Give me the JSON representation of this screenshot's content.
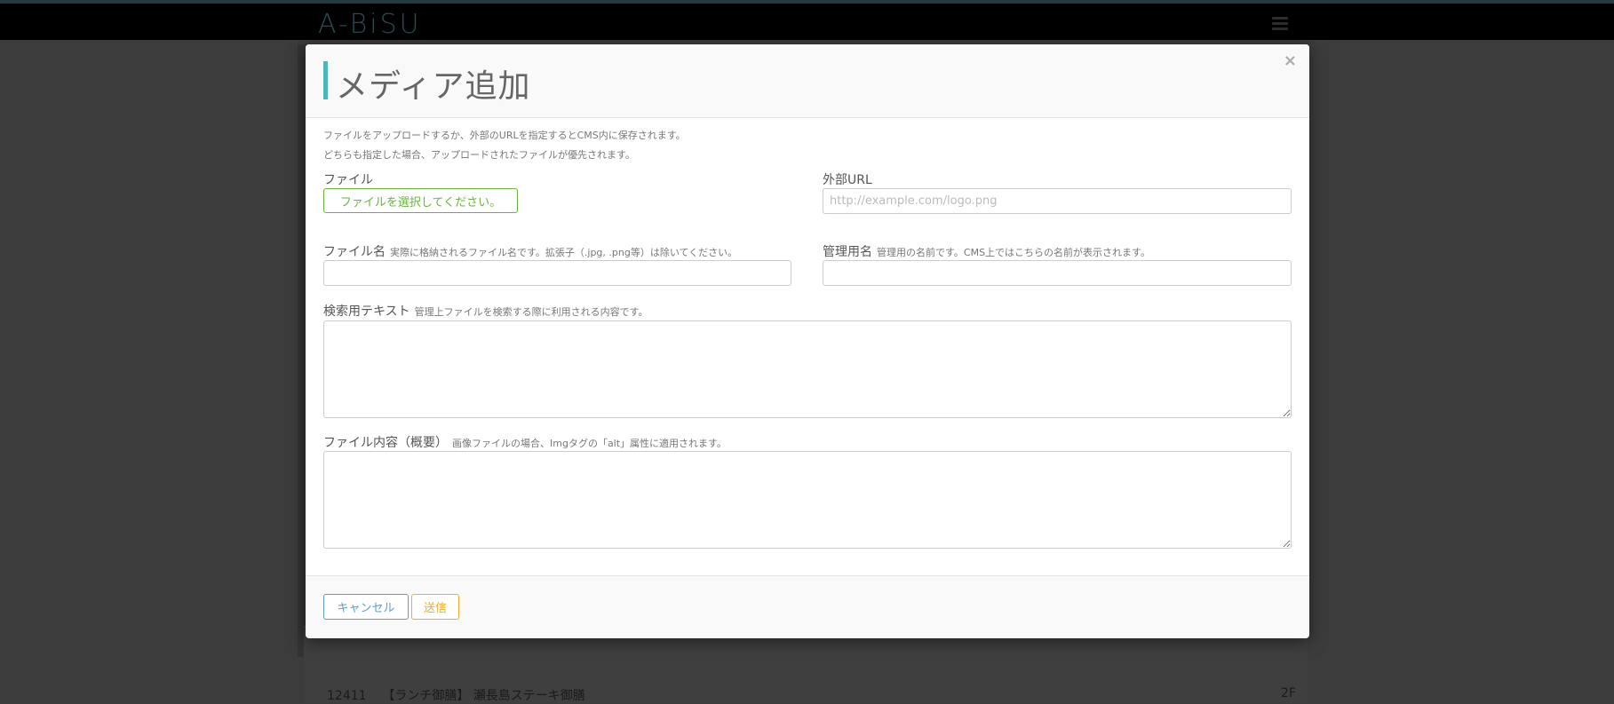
{
  "app": {
    "logo": "A-BiSU"
  },
  "background": {
    "row_id": "12411",
    "row_title": "【ランチ御膳】 瀬長島ステーキ御膳",
    "row_tail": "2F"
  },
  "modal": {
    "title": "メディア追加",
    "close": "×",
    "note_line1": "ファイルをアップロードするか、外部のURLを指定するとCMS内に保存されます。",
    "note_line2": "どちらも指定した場合、アップロードされたファイルが優先されます。",
    "file": {
      "label": "ファイル",
      "button": "ファイルを選択してください。"
    },
    "external_url": {
      "label": "外部URL",
      "value": "",
      "placeholder": "http://example.com/logo.png"
    },
    "file_name": {
      "label": "ファイル名",
      "hint": "実際に格納されるファイル名です。拡張子（.jpg, .png等）は除いてください。",
      "value": ""
    },
    "admin_name": {
      "label": "管理用名",
      "hint": "管理用の名前です。CMS上ではこちらの名前が表示されます。",
      "value": ""
    },
    "search_text": {
      "label": "検索用テキスト",
      "hint": "管理上ファイルを検索する際に利用される内容です。",
      "value": ""
    },
    "description": {
      "label": "ファイル内容（概要）",
      "hint": "画像ファイルの場合、Imgタグの「alt」属性に適用されます。",
      "value": ""
    },
    "cancel": "キャンセル",
    "send": "送信"
  }
}
